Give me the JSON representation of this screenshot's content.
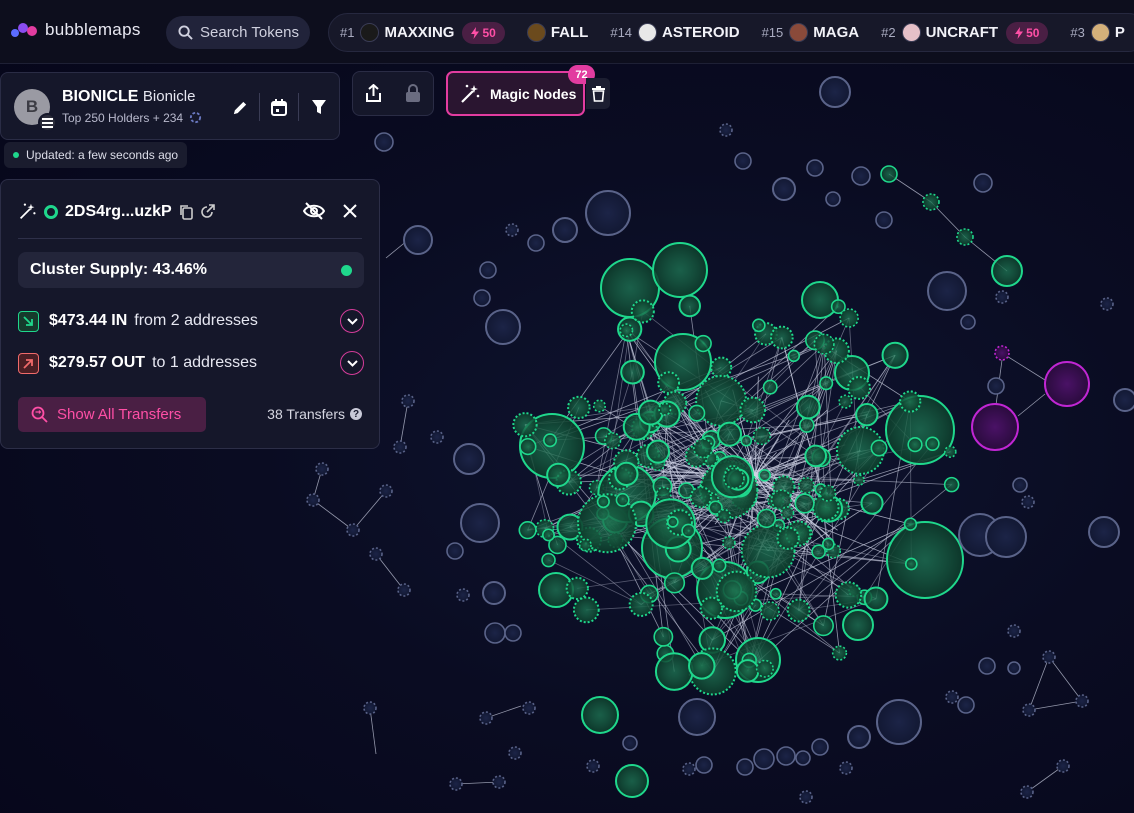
{
  "app": {
    "name": "bubblemaps"
  },
  "search": {
    "placeholder": "Search Tokens"
  },
  "trending": [
    {
      "rank": "#1",
      "name": "MAXXING",
      "boost": "50",
      "color": "#1a1a1a"
    },
    {
      "rank": "",
      "name": "FALL",
      "boost": "",
      "color": "#6b4a1d"
    },
    {
      "rank": "#14",
      "name": "ASTEROID",
      "boost": "",
      "color": "#e8e8e8"
    },
    {
      "rank": "#15",
      "name": "MAGA",
      "boost": "",
      "color": "#8a4a3a"
    },
    {
      "rank": "#2",
      "name": "UNCRAFT",
      "boost": "50",
      "color": "#e6c0c8"
    },
    {
      "rank": "#3",
      "name": "P",
      "boost": "",
      "color": "#d4b07a"
    }
  ],
  "token": {
    "avatar_letter": "B",
    "symbol": "BIONICLE",
    "name": "Bionicle",
    "subtitle": "Top 250 Holders + 234",
    "updated": "Updated: a few seconds ago"
  },
  "magic_nodes": {
    "label": "Magic Nodes",
    "count": "72"
  },
  "cluster": {
    "address": "2DS4rg...uzkP",
    "supply": "Cluster Supply: 43.46%",
    "in_amount": "$473.44 IN",
    "in_rest": "from 2 addresses",
    "out_amount": "$279.57 OUT",
    "out_rest": "to 1 addresses",
    "show_all": "Show All Transfers",
    "transfers": "38 Transfers"
  },
  "colors": {
    "green": "#1fd78c",
    "magenta": "#c026d3",
    "pink": "#e23ca0",
    "node_grey": "#5a6389"
  },
  "icons": [
    "search-icon",
    "bolt-icon",
    "pencil-icon",
    "calendar-icon",
    "filter-icon",
    "share-icon",
    "lock-icon",
    "magic-wand-icon",
    "trash-icon",
    "copy-icon",
    "external-link-icon",
    "eye-off-icon",
    "close-icon",
    "arrow-in-icon",
    "arrow-out-icon",
    "chevron-down-icon",
    "transfers-icon",
    "help-icon"
  ]
}
